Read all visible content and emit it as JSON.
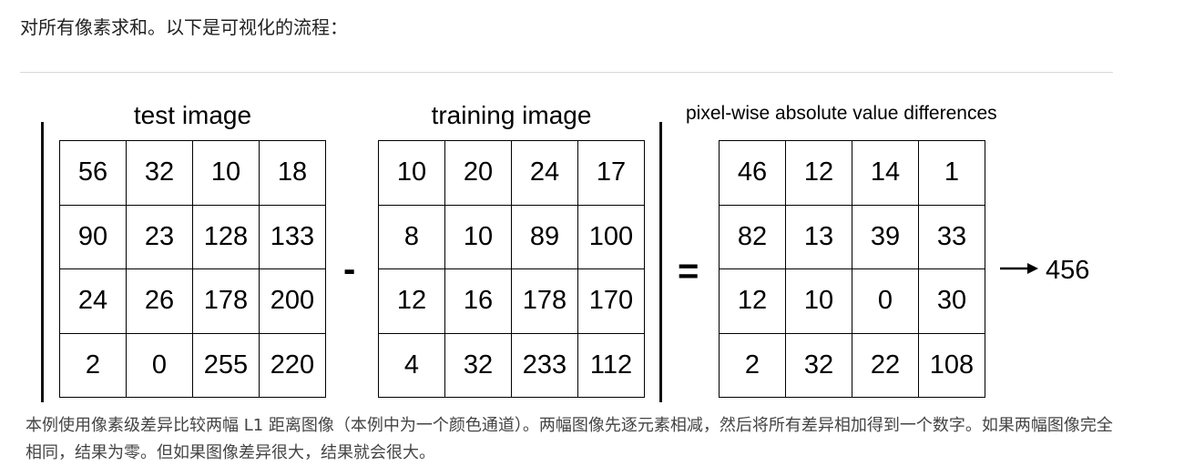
{
  "intro_text": "对所有像素求和。以下是可视化的流程：",
  "diagram": {
    "test_image": {
      "title": "test image",
      "rows": [
        [
          56,
          32,
          10,
          18
        ],
        [
          90,
          23,
          128,
          133
        ],
        [
          24,
          26,
          178,
          200
        ],
        [
          2,
          0,
          255,
          220
        ]
      ]
    },
    "training_image": {
      "title": "training image",
      "rows": [
        [
          10,
          20,
          24,
          17
        ],
        [
          8,
          10,
          89,
          100
        ],
        [
          12,
          16,
          178,
          170
        ],
        [
          4,
          32,
          233,
          112
        ]
      ]
    },
    "differences": {
      "title": "pixel-wise absolute value differences",
      "rows": [
        [
          46,
          12,
          14,
          1
        ],
        [
          82,
          13,
          39,
          33
        ],
        [
          12,
          10,
          0,
          30
        ],
        [
          2,
          32,
          22,
          108
        ]
      ]
    },
    "minus_symbol": "-",
    "equals_symbol": "=",
    "result": "456",
    "arrow_icon": "right-arrow-icon"
  },
  "caption": "本例使用像素级差异比较两幅 L1 距离图像（本例中为一个颜色通道）。两幅图像先逐元素相减，然后将所有差异相加得到一个数字。如果两幅图像完全相同，结果为零。但如果图像差异很大，结果就会很大。"
}
